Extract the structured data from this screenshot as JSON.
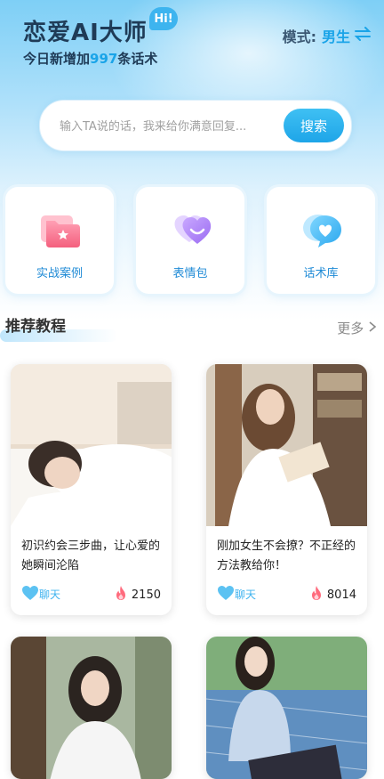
{
  "header": {
    "title": "恋爱AI大师",
    "badge": "Hi!",
    "subtitle_prefix": "今日新增加",
    "subtitle_count": "997",
    "subtitle_suffix": "条话术",
    "mode_label": "模式:",
    "mode_value": "男生",
    "mode_swap_icon": "swap-icon"
  },
  "search": {
    "placeholder": "输入TA说的话，我来给你满意回复...",
    "button": "搜索"
  },
  "features": [
    {
      "label": "实战案例",
      "icon": "folder-star-icon"
    },
    {
      "label": "表情包",
      "icon": "heart-smile-icon"
    },
    {
      "label": "话术库",
      "icon": "chat-heart-icon"
    }
  ],
  "section": {
    "title": "推荐教程",
    "more": "更多"
  },
  "posts": [
    {
      "title": "初识约会三步曲，让心爱的她瞬间沦陷",
      "like_label": "聊天",
      "count": "2150"
    },
    {
      "title": "刚加女生不会撩？不正经的方法教给你！",
      "like_label": "聊天",
      "count": "8014"
    },
    {
      "title": "",
      "like_label": "",
      "count": ""
    },
    {
      "title": "",
      "like_label": "",
      "count": ""
    }
  ],
  "colors": {
    "accent": "#1aa4e8",
    "title": "#1f3b57"
  }
}
